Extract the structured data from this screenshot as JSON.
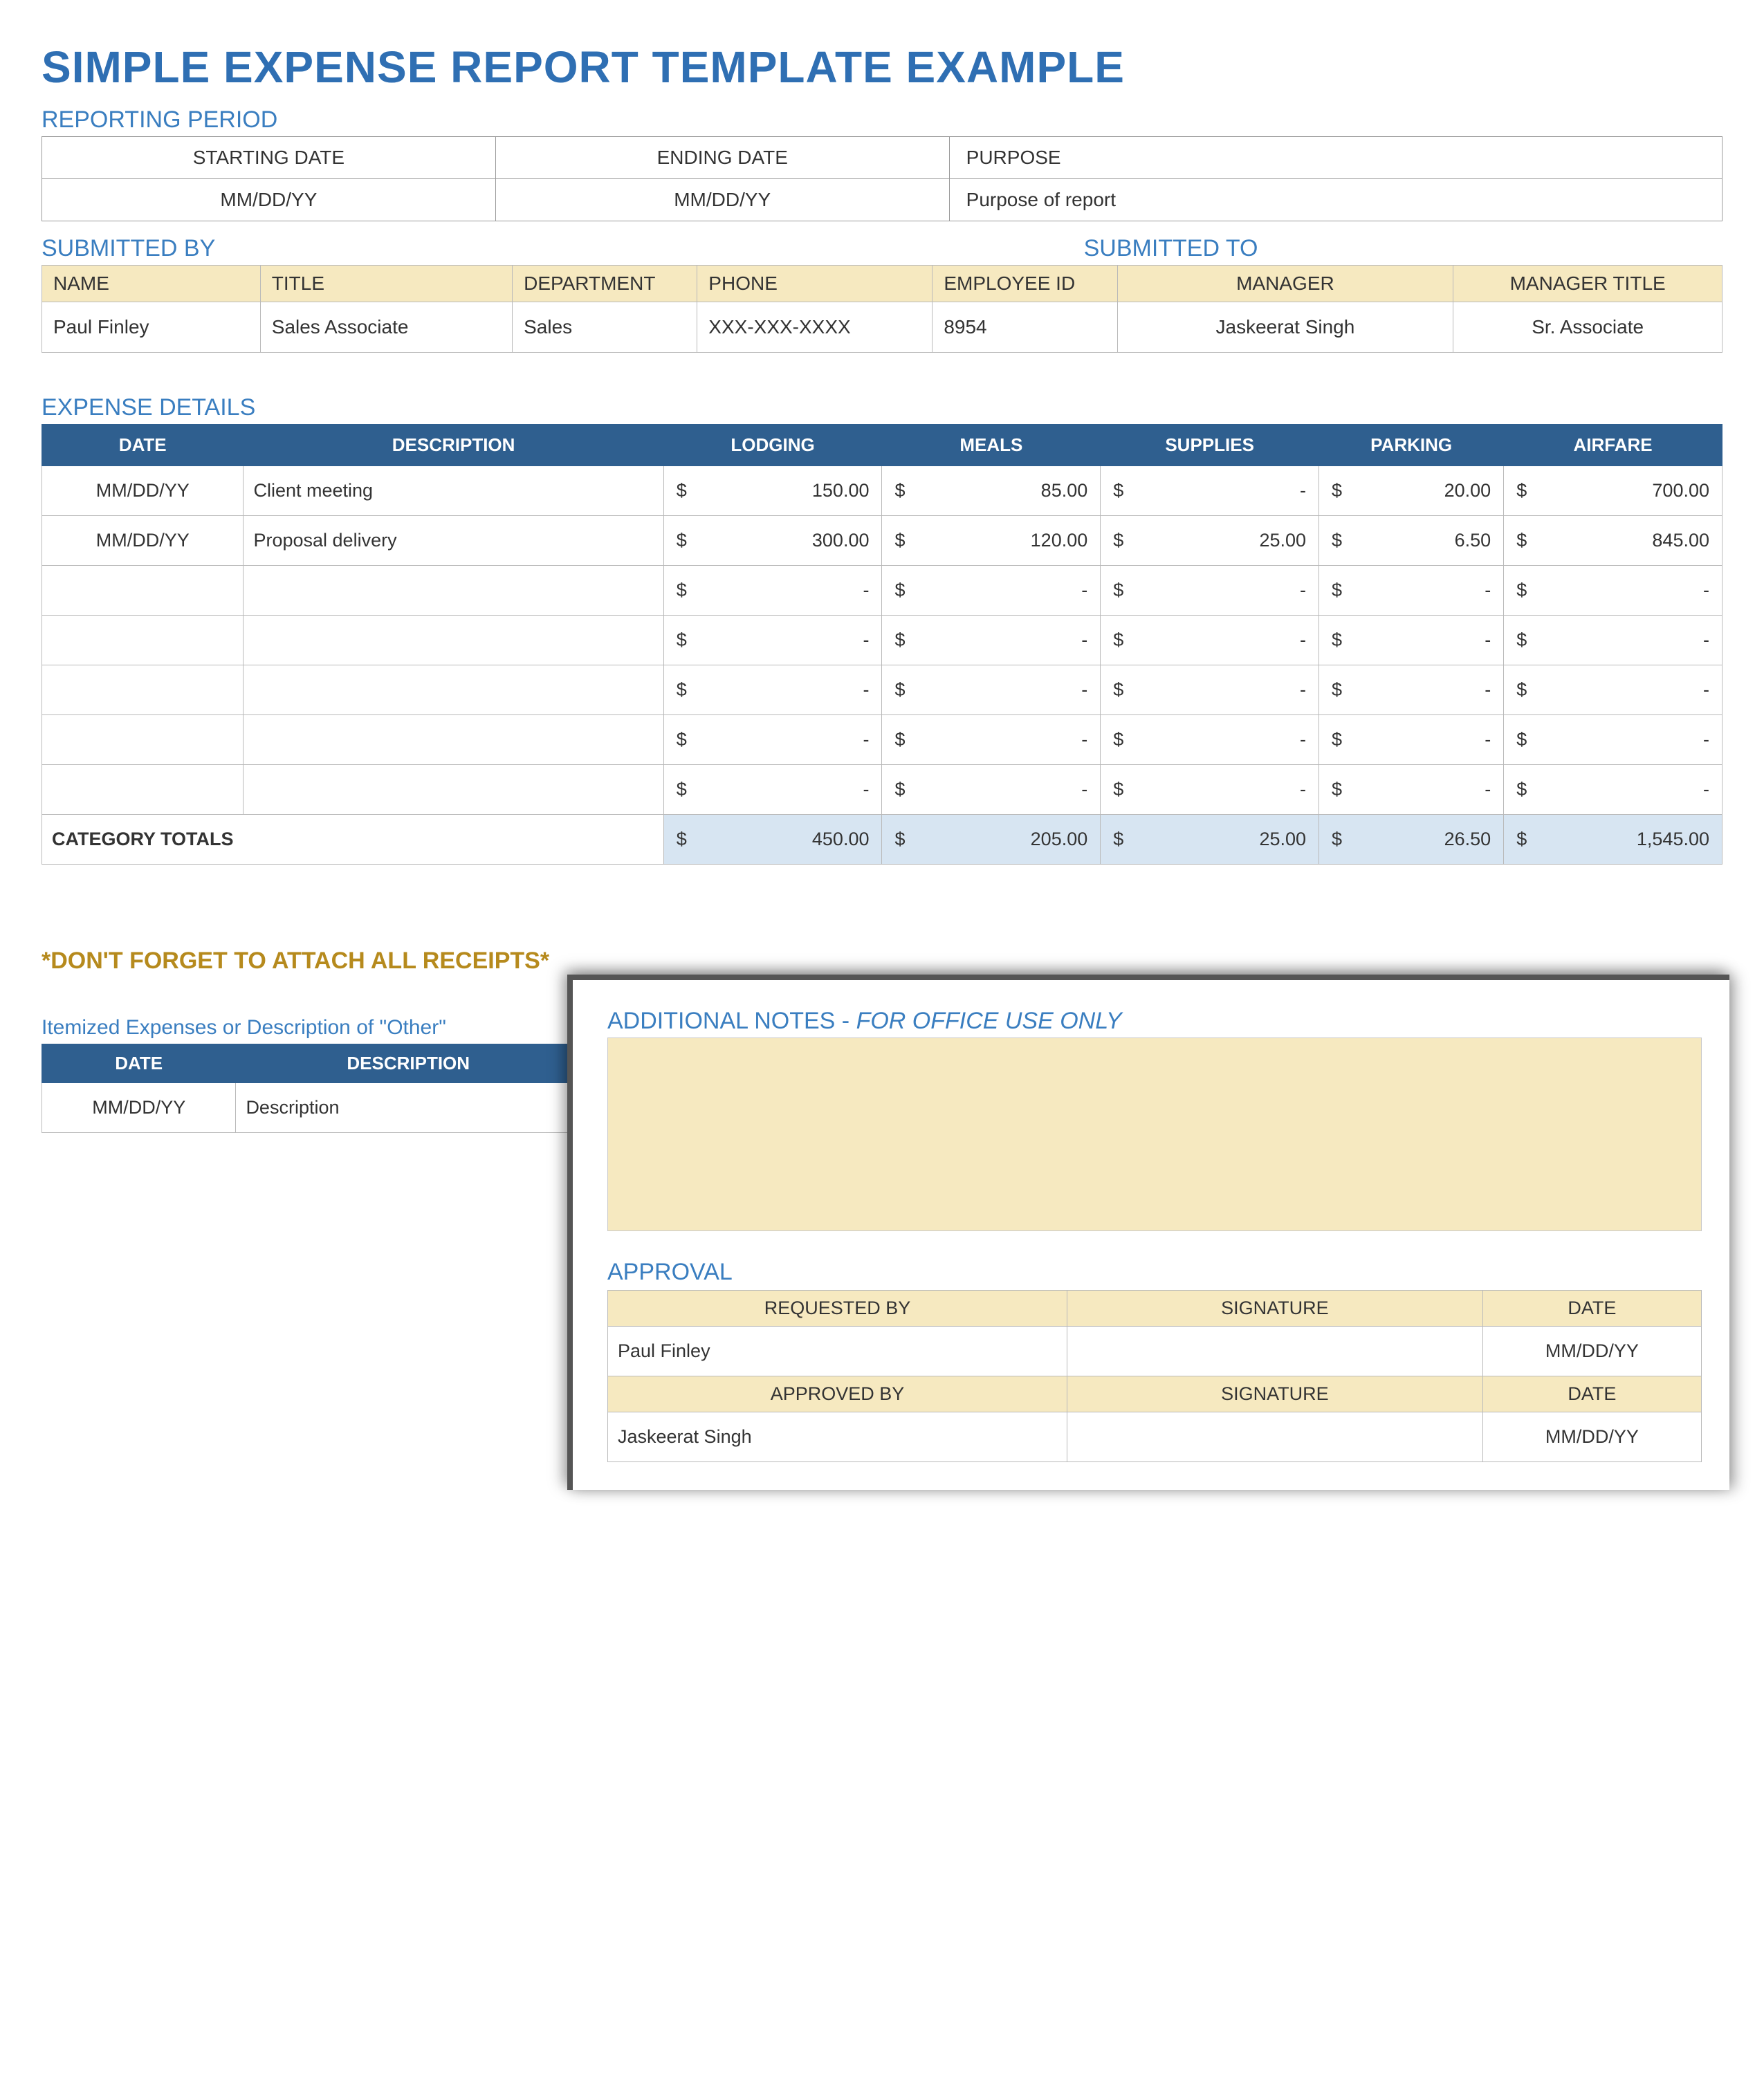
{
  "title": "SIMPLE EXPENSE REPORT TEMPLATE EXAMPLE",
  "period": {
    "label": "REPORTING PERIOD",
    "headers": {
      "start": "STARTING DATE",
      "end": "ENDING DATE",
      "purpose": "PURPOSE"
    },
    "start": "MM/DD/YY",
    "end": "MM/DD/YY",
    "purpose": "Purpose of report"
  },
  "submitted": {
    "by_label": "SUBMITTED BY",
    "to_label": "SUBMITTED TO",
    "headers": {
      "name": "NAME",
      "title": "TITLE",
      "dept": "DEPARTMENT",
      "phone": "PHONE",
      "emp": "EMPLOYEE ID",
      "mgr": "MANAGER",
      "mgr_title": "MANAGER TITLE"
    },
    "row": {
      "name": "Paul Finley",
      "title": "Sales Associate",
      "dept": "Sales",
      "phone": "XXX-XXX-XXXX",
      "emp": "8954",
      "mgr": "Jaskeerat Singh",
      "mgr_title": "Sr. Associate"
    }
  },
  "expenses": {
    "label": "EXPENSE DETAILS",
    "headers": {
      "date": "DATE",
      "desc": "DESCRIPTION",
      "lodging": "LODGING",
      "meals": "MEALS",
      "supplies": "SUPPLIES",
      "parking": "PARKING",
      "airfare": "AIRFARE"
    },
    "rows": [
      {
        "date": "MM/DD/YY",
        "desc": "Client meeting",
        "lodging": "150.00",
        "meals": "85.00",
        "supplies": "-",
        "parking": "20.00",
        "airfare": "700.00"
      },
      {
        "date": "MM/DD/YY",
        "desc": "Proposal delivery",
        "lodging": "300.00",
        "meals": "120.00",
        "supplies": "25.00",
        "parking": "6.50",
        "airfare": "845.00"
      },
      {
        "date": "",
        "desc": "",
        "lodging": "-",
        "meals": "-",
        "supplies": "-",
        "parking": "-",
        "airfare": "-"
      },
      {
        "date": "",
        "desc": "",
        "lodging": "-",
        "meals": "-",
        "supplies": "-",
        "parking": "-",
        "airfare": "-"
      },
      {
        "date": "",
        "desc": "",
        "lodging": "-",
        "meals": "-",
        "supplies": "-",
        "parking": "-",
        "airfare": "-"
      },
      {
        "date": "",
        "desc": "",
        "lodging": "-",
        "meals": "-",
        "supplies": "-",
        "parking": "-",
        "airfare": "-"
      },
      {
        "date": "",
        "desc": "",
        "lodging": "-",
        "meals": "-",
        "supplies": "-",
        "parking": "-",
        "airfare": "-"
      }
    ],
    "totals_label": "CATEGORY TOTALS",
    "totals": {
      "lodging": "450.00",
      "meals": "205.00",
      "supplies": "25.00",
      "parking": "26.50",
      "airfare": "1,545.00"
    },
    "currency": "$"
  },
  "reminder": "*DON'T FORGET TO ATTACH ALL RECEIPTS*",
  "itemized": {
    "label": "Itemized Expenses or Description of \"Other\"",
    "headers": {
      "date": "DATE",
      "desc": "DESCRIPTION"
    },
    "row": {
      "date": "MM/DD/YY",
      "desc": "Description"
    }
  },
  "notes": {
    "label_a": "ADDITIONAL NOTES - ",
    "label_b": "FOR OFFICE USE ONLY"
  },
  "approval": {
    "label": "APPROVAL",
    "headers": {
      "req": "REQUESTED BY",
      "sig": "SIGNATURE",
      "date": "DATE",
      "app": "APPROVED BY"
    },
    "requested_by": "Paul Finley",
    "requested_date": "MM/DD/YY",
    "approved_by": "Jaskeerat Singh",
    "approved_date": "MM/DD/YY"
  }
}
